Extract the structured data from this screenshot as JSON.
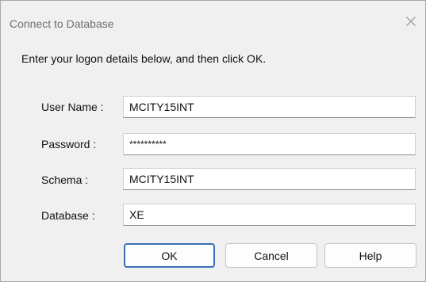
{
  "dialog": {
    "title": "Connect to Database",
    "instruction": "Enter your logon details below, and then click OK."
  },
  "fields": {
    "user_name": {
      "label": "User Name :",
      "value": "MCITY15INT"
    },
    "password": {
      "label": "Password :",
      "value": "**********"
    },
    "schema": {
      "label": "Schema :",
      "value": "MCITY15INT"
    },
    "database": {
      "label": "Database :",
      "value": "XE"
    }
  },
  "buttons": {
    "ok": "OK",
    "cancel": "Cancel",
    "help": "Help"
  },
  "colors": {
    "accent": "#3a6fb6",
    "background": "#f0f0f0"
  },
  "icons": {
    "close": "close-icon"
  }
}
